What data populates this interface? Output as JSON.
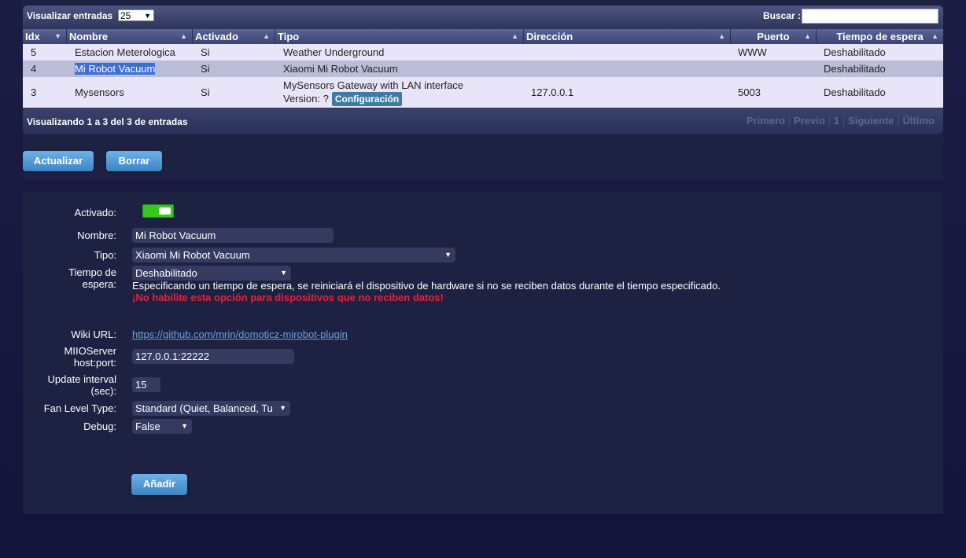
{
  "table": {
    "length_label": "Visualizar entradas",
    "length_value": "25",
    "search_label": "Buscar :",
    "search_value": "",
    "columns": [
      "Idx",
      "Nombre",
      "Activado",
      "Tipo",
      "Dirección",
      "Puerto",
      "Tiempo de espera"
    ],
    "rows": [
      {
        "idx": "5",
        "name": "Estacion Meterologica",
        "enabled": "Si",
        "type": "Weather Underground",
        "address": "",
        "port": "WWW",
        "timeout": "Deshabilitado"
      },
      {
        "idx": "4",
        "name": "Mi Robot Vacuum",
        "enabled": "Si",
        "type": "Xiaomi Mi Robot Vacuum",
        "address": "",
        "port": "",
        "timeout": "Deshabilitado"
      },
      {
        "idx": "3",
        "name": "Mysensors",
        "enabled": "Si",
        "type": "MySensors Gateway with LAN interface",
        "type_line2": "Version: ?",
        "config_button": "Configuración",
        "address": "127.0.0.1",
        "port": "5003",
        "timeout": "Deshabilitado"
      }
    ],
    "info": "Visualizando 1 a 3 del 3 de entradas",
    "pager": [
      "Primero",
      "Previo",
      "1",
      "Siguiente",
      "Último"
    ]
  },
  "actions": {
    "update": "Actualizar",
    "delete": "Borrar"
  },
  "form": {
    "enabled_label": "Activado:",
    "enabled": true,
    "name_label": "Nombre:",
    "name_value": "Mi Robot Vacuum",
    "type_label": "Tipo:",
    "type_value": "Xiaomi Mi Robot Vacuum",
    "timeout_label_1": "Tiempo de",
    "timeout_label_2": "espera:",
    "timeout_value": "Deshabilitado",
    "timeout_help": "Especificando un tiempo de espera, se reiniciará el dispositivo de hardware si no se reciben datos durante el tiempo especificado.",
    "timeout_warning": "¡No habilite esta opción para dispositivos que no reciben datos!",
    "wiki_label": "Wiki URL:",
    "wiki_url": "https://github.com/mrin/domoticz-mirobot-plugin",
    "miio_label_1": "MIIOServer",
    "miio_label_2": "host:port:",
    "miio_value": "127.0.0.1:22222",
    "interval_label_1": "Update interval",
    "interval_label_2": "(sec):",
    "interval_value": "15",
    "fan_label": "Fan Level Type:",
    "fan_value": "Standard (Quiet, Balanced, Tu",
    "debug_label": "Debug:",
    "debug_value": "False",
    "add_button": "Añadir"
  },
  "colors": {
    "accent": "#3b84c4",
    "toggle_on": "#35c91e",
    "warning": "#e8203a",
    "link": "#6ba0e0"
  }
}
